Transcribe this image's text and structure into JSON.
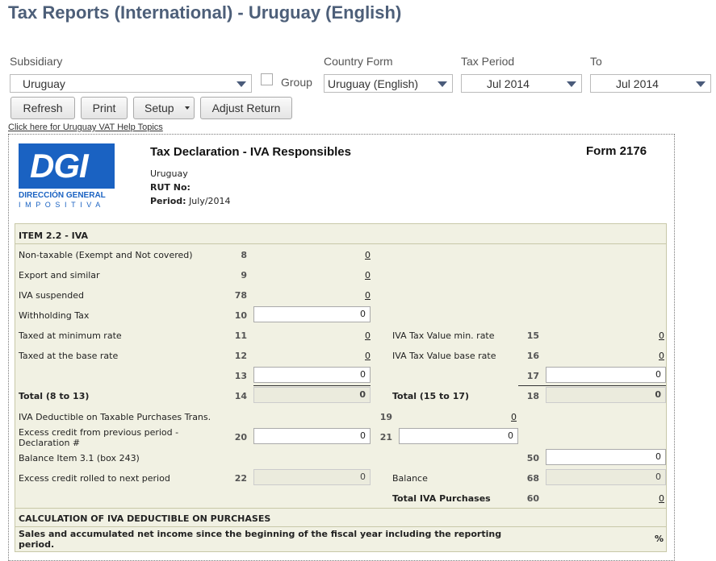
{
  "page": {
    "title": "Tax Reports (International) - Uruguay (English)"
  },
  "filters": {
    "subsidiary_label": "Subsidiary",
    "subsidiary_value": "Uruguay",
    "group_label": "Group",
    "country_form_label": "Country Form",
    "country_form_value": "Uruguay (English)",
    "tax_period_label": "Tax Period",
    "tax_period_value": "Jul 2014",
    "to_label": "To",
    "to_value": "Jul 2014"
  },
  "toolbar": {
    "refresh": "Refresh",
    "print": "Print",
    "setup": "Setup",
    "adjust": "Adjust Return"
  },
  "help_link": "Click here for Uruguay VAT Help Topics",
  "header": {
    "logo_letters": "DGI",
    "logo_line1": "DIRECCIÓN GENERAL",
    "logo_line2": "IMPOSITIVA",
    "title": "Tax Declaration - IVA Responsibles",
    "form_no": "Form 2176",
    "country": "Uruguay",
    "rut_label": "RUT No:",
    "period_label": "Period:",
    "period_value": "July/2014"
  },
  "section1": {
    "heading": "ITEM 2.2 - IVA",
    "rows": [
      {
        "label": "Non-taxable (Exempt and Not covered)",
        "box": "8",
        "value": "0"
      },
      {
        "label": "Export and similar",
        "box": "9",
        "value": "0"
      },
      {
        "label": "IVA suspended",
        "box": "78",
        "value": "0"
      },
      {
        "label": "Withholding Tax",
        "box": "10",
        "value": "0"
      },
      {
        "label": "Taxed at minimum rate",
        "box": "11",
        "value": "0"
      },
      {
        "label": "Taxed at the base rate",
        "box": "12",
        "value": "0"
      },
      {
        "label": "",
        "box": "13",
        "value": "0"
      },
      {
        "label": "Total (8 to 13)",
        "box": "14",
        "value": "0"
      }
    ],
    "right_rows": [
      {
        "label": "IVA Tax Value min. rate",
        "box": "15",
        "value": "0"
      },
      {
        "label": "IVA Tax Value base rate",
        "box": "16",
        "value": "0"
      },
      {
        "label": "",
        "box": "17",
        "value": "0"
      },
      {
        "label": "Total (15 to 17)",
        "box": "18",
        "value": "0"
      }
    ],
    "deductible_label": "IVA Deductible on Taxable Purchases Trans.",
    "deductible_box": "19",
    "deductible_value": "0",
    "excess_label_1": "Excess credit from previous period -",
    "excess_label_2": "Declaration #",
    "excess_box": "20",
    "excess_value": "0",
    "excess_box2": "21",
    "excess_value2": "0",
    "balance_item_label": "Balance Item 3.1 (box 243)",
    "balance_item_box": "50",
    "balance_item_value": "0",
    "rolled_label": "Excess credit rolled to next period",
    "rolled_box": "22",
    "rolled_value": "0",
    "balance_label": "Balance",
    "balance_box": "68",
    "balance_value": "0",
    "total_purchases_label": "Total IVA Purchases",
    "total_purchases_box": "60",
    "total_purchases_value": "0"
  },
  "section2": {
    "heading": "CALCULATION OF IVA DEDUCTIBLE ON PURCHASES",
    "sales_label_1": "Sales and accumulated net income since the beginning of the fiscal year including the reporting",
    "sales_label_2": "period.",
    "percent": "%"
  },
  "colors": {
    "title": "#4d5f79",
    "logo_blue": "#1a62c2",
    "panel_bg": "#f1f1e3"
  }
}
